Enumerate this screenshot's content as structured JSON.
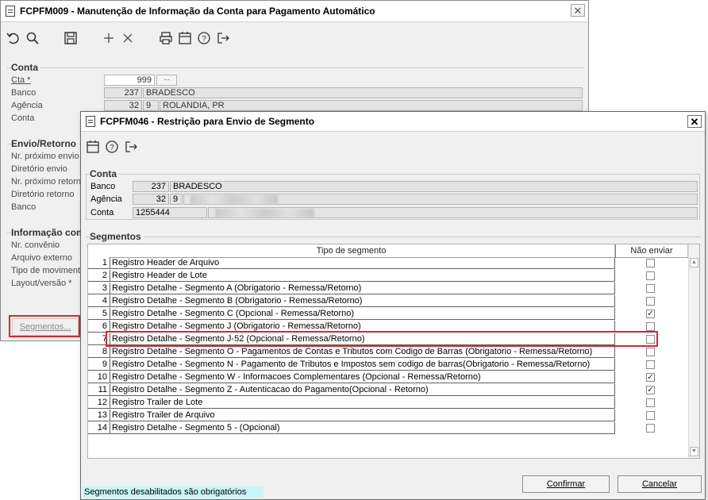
{
  "bg_window": {
    "title": "FCPFM009 - Manutenção de Informação da Conta para Pagamento Automático",
    "close_glyph": "✕",
    "toolbar_icons": [
      "undo-icon",
      "search-icon",
      "save-icon",
      "add-icon",
      "delete-icon",
      "print-icon",
      "calendar-icon",
      "help-icon",
      "exit-icon"
    ],
    "conta": {
      "group": "Conta",
      "cta_label": "Cta *",
      "cta_value": "999",
      "banco_label": "Banco",
      "banco_code": "237",
      "banco_name": "BRADESCO",
      "agencia_label": "Agência",
      "agencia_code": "32",
      "agencia_dv": "9",
      "agencia_name": "ROLANDIA, PR",
      "conta_label": "Conta"
    },
    "envio": {
      "group": "Envio/Retorno",
      "labels": [
        "Nr. próximo envio",
        "Diretório envio",
        "Nr. próximo retorno",
        "Diretório retorno",
        "Banco"
      ]
    },
    "info": {
      "group": "Informação com",
      "labels": [
        "Nr. convênio",
        "Arquivo externo",
        "Tipo de movimento",
        "Layout/versão *"
      ]
    },
    "segmentos_button": "Segmentos..."
  },
  "dialog": {
    "title": "FCPFM046 - Restrição para Envio de Segmento",
    "close_glyph": "✕",
    "toolbar_icons": [
      "calendar-icon",
      "help-icon",
      "exit-icon"
    ],
    "conta": {
      "group": "Conta",
      "banco_label": "Banco",
      "banco_code": "237",
      "banco_name": "BRADESCO",
      "agencia_label": "Agência",
      "agencia_code": "32",
      "agencia_dv": "9",
      "conta_label": "Conta",
      "conta_value": "1255444"
    },
    "segmentos": {
      "group": "Segmentos",
      "col_tipo": "Tipo de segmento",
      "col_nao_enviar": "Não enviar",
      "rows": [
        {
          "num": "1",
          "label": "Registro Header de Arquivo",
          "checked": false
        },
        {
          "num": "2",
          "label": "Registro Header de Lote",
          "checked": false
        },
        {
          "num": "3",
          "label": "Registro Detalhe - Segmento A (Obrigatorio - Remessa/Retorno)",
          "checked": false
        },
        {
          "num": "4",
          "label": "Registro Detalhe - Segmento B (Obrigatorio - Remessa/Retorno)",
          "checked": false
        },
        {
          "num": "5",
          "label": "Registro Detalhe - Segmento C (Opcional - Remessa/Retorno)",
          "checked": true
        },
        {
          "num": "6",
          "label": "Registro Detalhe - Segmento J (Obrigatorio - Remessa/Retorno)",
          "checked": false
        },
        {
          "num": "7",
          "label": "Registro Detalhe - Segmento J-52 (Opcional - Remessa/Retorno)",
          "checked": false
        },
        {
          "num": "8",
          "label": "Registro Detalhe - Segmento O - Pagamentos de Contas e Tributos com Codigo de Barras (Obrigatorio - Remessa/Retorno)",
          "checked": false
        },
        {
          "num": "9",
          "label": "Registro Detalhe - Segmento N - Pagamento de Tributos e Impostos sem codigo de barras(Obrigatorio - Remessa/Retorno)",
          "checked": false
        },
        {
          "num": "10",
          "label": "Registro Detalhe - Segmento W - Informacoes Complementares (Opcional - Remessa/Retorno)",
          "checked": true
        },
        {
          "num": "11",
          "label": "Registro Detalhe - Segmento Z - Autenticacao do Pagamento(Opcional - Retorno)",
          "checked": true
        },
        {
          "num": "12",
          "label": "Registro Trailer de Lote",
          "checked": false
        },
        {
          "num": "13",
          "label": "Registro Trailer de Arquivo",
          "checked": false
        },
        {
          "num": "14",
          "label": "Registro Detalhe - Segmento 5 - (Opcional)",
          "checked": false
        }
      ]
    },
    "status_text": "Segmentos desabilitados são obrigatórios",
    "confirm_button": "Confirmar",
    "cancel_button": "Cancelar",
    "check_glyph": "✓",
    "scroll_up_glyph": "▲",
    "scroll_down_glyph": "▼"
  },
  "colors": {
    "highlight": "#d72a2a",
    "status_bg": "#c8f7f7"
  }
}
